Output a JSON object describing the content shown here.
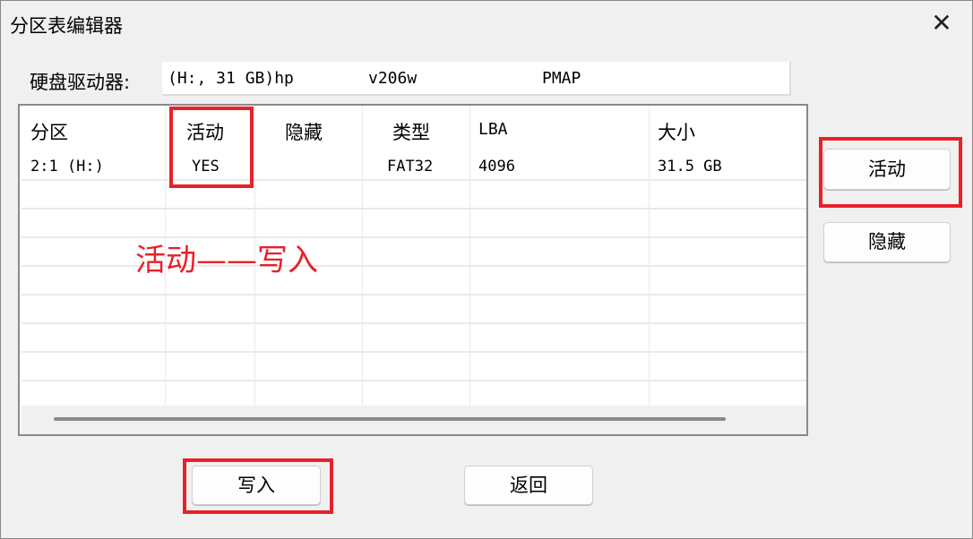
{
  "window": {
    "title": "分区表编辑器",
    "close_icon": "close-icon"
  },
  "drive": {
    "label": "硬盘驱动器:",
    "value_parts": [
      "(H:, 31 GB)hp",
      "v206w",
      "PMAP"
    ]
  },
  "table": {
    "columns": [
      "分区",
      "活动",
      "隐藏",
      "类型",
      "LBA",
      "大小"
    ],
    "rows": [
      [
        "2:1 (H:)",
        "YES",
        "",
        "FAT32",
        "4096",
        "31.5 GB"
      ]
    ]
  },
  "buttons": {
    "active": "活动",
    "hide": "隐藏",
    "write": "写入",
    "back": "返回"
  },
  "annotation": {
    "text": "活动——写入",
    "color": "#e8202a"
  }
}
